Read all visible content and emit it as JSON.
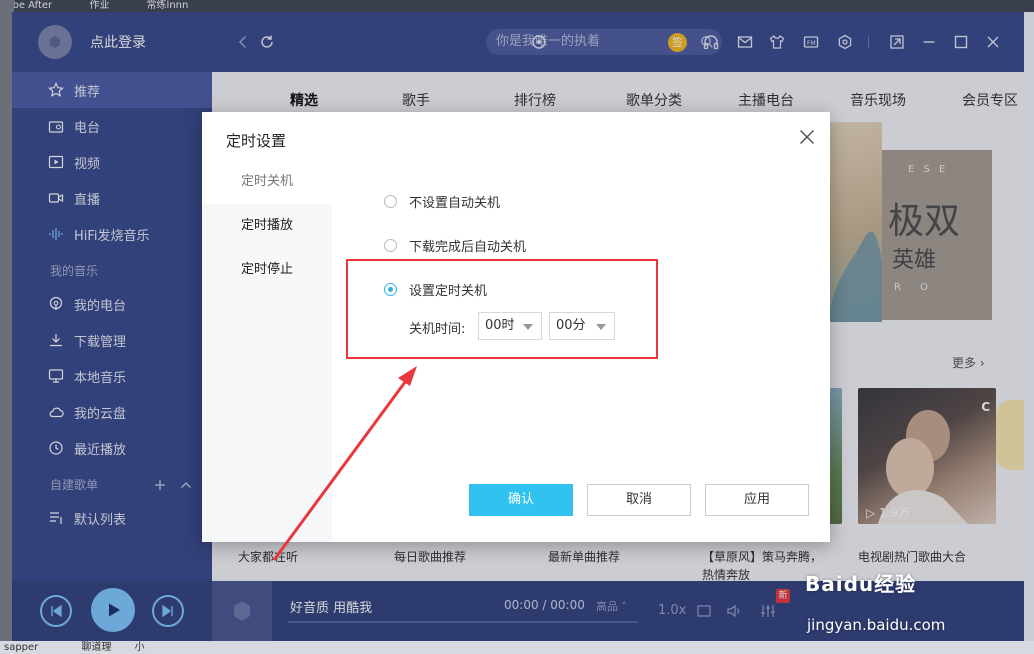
{
  "desktop": {
    "top_strip": [
      "dobe After",
      "作业",
      "常练lnnn"
    ],
    "bottom_strip": [
      "sapper",
      "聊道理",
      "小"
    ]
  },
  "user": {
    "login_label": "点此登录"
  },
  "sidebar": {
    "items": [
      {
        "label": "推荐",
        "icon": "star-icon"
      },
      {
        "label": "电台",
        "icon": "radio-icon"
      },
      {
        "label": "视频",
        "icon": "video-icon"
      },
      {
        "label": "直播",
        "icon": "camera-icon"
      },
      {
        "label": "HiFi发烧音乐",
        "icon": "waveform-icon"
      }
    ],
    "my_music_title": "我的音乐",
    "my_items": [
      {
        "label": "我的电台",
        "icon": "podcast-icon"
      },
      {
        "label": "下载管理",
        "icon": "download-icon"
      },
      {
        "label": "本地音乐",
        "icon": "monitor-icon"
      },
      {
        "label": "我的云盘",
        "icon": "cloud-icon"
      },
      {
        "label": "最近播放",
        "icon": "clock-icon"
      }
    ],
    "playlist_title": "自建歌单",
    "playlists": [
      {
        "label": "默认列表",
        "icon": "list-icon"
      }
    ]
  },
  "search": {
    "placeholder": "你是我唯一的执着"
  },
  "topbar": {
    "sign_badge": "签"
  },
  "tabs": [
    "精选",
    "歌手",
    "排行榜",
    "歌单分类",
    "主播电台",
    "音乐现场",
    "会员专区"
  ],
  "banner": {
    "letters": "E S E",
    "big_text": "极双",
    "sub_text": "英雄",
    "bottom_letters": "R O"
  },
  "content": {
    "more_label": "更多",
    "cards": [
      {
        "title": "大家都在听"
      },
      {
        "title": "每日歌曲推荐"
      },
      {
        "title": "最新单曲推荐"
      },
      {
        "title": "【草原风】策马奔腾，热情奔放"
      },
      {
        "title": "电视剧热门歌曲大合",
        "play_count": "1.9万"
      }
    ]
  },
  "player": {
    "track": "好音质 用酷我",
    "time": "00:00 / 00:00",
    "quality": "高品",
    "speed": "1.0x",
    "new_badge": "新"
  },
  "dialog": {
    "title": "定时设置",
    "side": [
      "定时关机",
      "定时播放",
      "定时停止"
    ],
    "options": [
      "不设置自动关机",
      "下载完成后自动关机",
      "设置定时关机"
    ],
    "selected_option_index": 2,
    "time_label": "关机时间:",
    "hour_value": "00时",
    "minute_value": "00分",
    "buttons": {
      "confirm": "确认",
      "cancel": "取消",
      "apply": "应用"
    }
  },
  "watermark": {
    "brand": "Baidu经验",
    "url": "jingyan.baidu.com"
  },
  "colors": {
    "sidebar": "#3a4a8c",
    "accent": "#31c2ef",
    "highlight": "#e8383d"
  }
}
